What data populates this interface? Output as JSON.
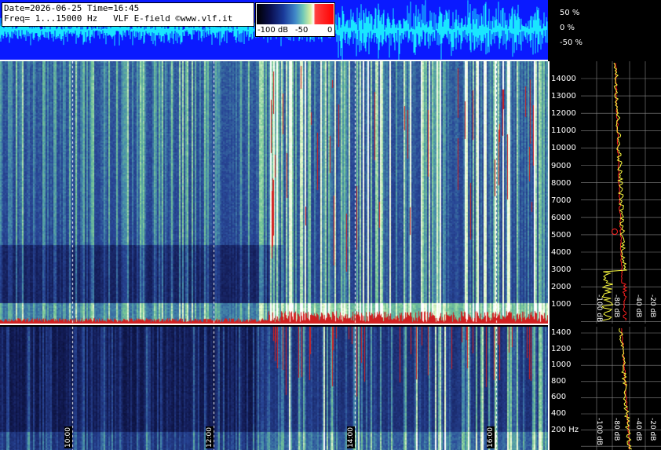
{
  "info": {
    "line1": "Date=2026-06-25 Time=16:45",
    "line2": "Freq= 1...15000 Hz   VLF E-field ©www.vlf.it"
  },
  "colorbar": {
    "label_min": "-100 dB",
    "label_mid": "-50",
    "label_max": "0"
  },
  "waveform_scale": {
    "top": "50 %",
    "mid": "0 %",
    "bottom": "-50 %"
  },
  "freq_axis_main": [
    "14000",
    "13000",
    "12000",
    "11000",
    "10000",
    "9000",
    "8000",
    "7000",
    "6000",
    "5000",
    "4000",
    "3000",
    "2000",
    "1000"
  ],
  "freq_axis_low": [
    "1400",
    "1200",
    "1000",
    "800",
    "600",
    "400",
    "200 Hz"
  ],
  "time_labels": [
    "10:00",
    "12:00",
    "14:00",
    "16:00"
  ],
  "db_axis": [
    "-100 dB",
    "-80 dB",
    "-40 dB",
    "-20 dB"
  ],
  "db_axis_low": [
    "-100 dB",
    "-80 dB",
    "-40 dB",
    "-20 dB"
  ],
  "colors": {
    "waveform_bg": "#0a1aff",
    "waveform_line": "#19e6ff",
    "spectrum_curve": "#ffff40",
    "average_curve": "#ff2020"
  }
}
